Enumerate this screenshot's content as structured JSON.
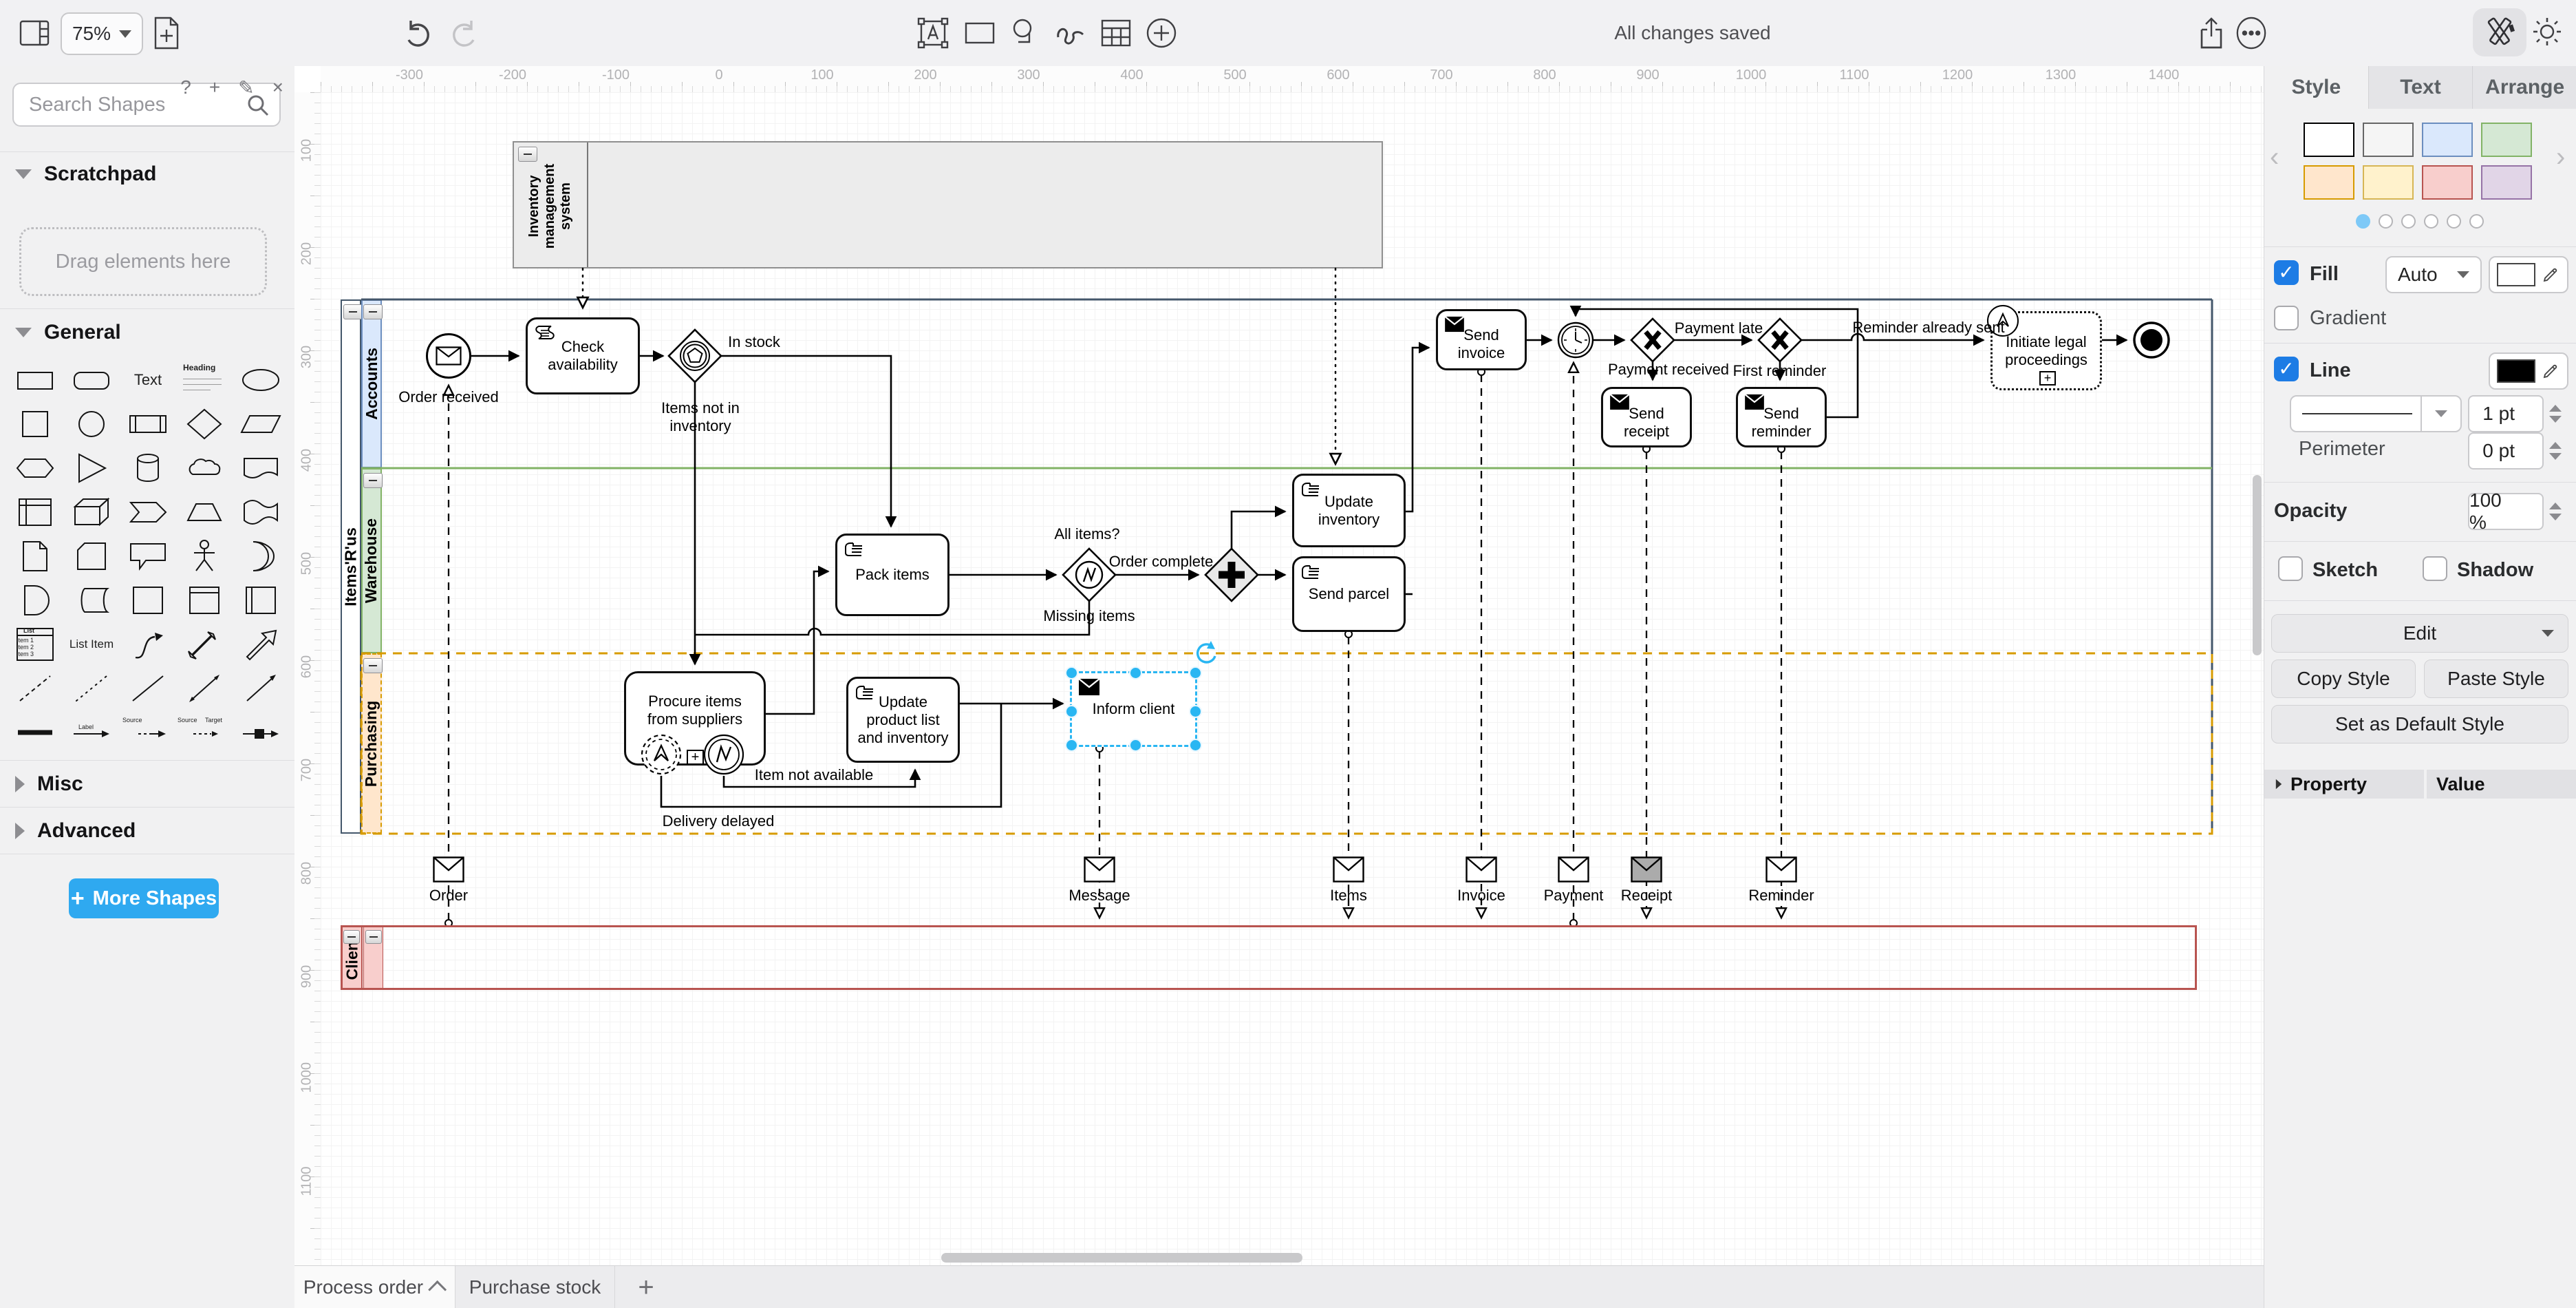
{
  "toolbar": {
    "zoom": "75%",
    "status": "All changes saved"
  },
  "sidebar": {
    "search_placeholder": "Search Shapes",
    "scratchpad_title": "Scratchpad",
    "drag_hint": "Drag elements here",
    "section_general": "General",
    "section_misc": "Misc",
    "section_advanced": "Advanced",
    "more_shapes": "More Shapes",
    "palette": {
      "text": "Text",
      "heading": "Heading",
      "list": "List",
      "item1": "Item 1",
      "item2": "Item 2",
      "item3": "Item 3",
      "list_item": "List Item",
      "label": "Label",
      "source": "Source",
      "target": "Target"
    }
  },
  "rulers": {
    "top": [
      "-300",
      "-200",
      "-100",
      "0",
      "100",
      "200",
      "300",
      "400",
      "500",
      "600",
      "700",
      "800",
      "900",
      "1000",
      "1100",
      "1200",
      "1300",
      "1400"
    ],
    "left": [
      "100",
      "200",
      "300",
      "400",
      "500",
      "600",
      "700",
      "800",
      "900",
      "1000",
      "1100"
    ]
  },
  "diagram": {
    "ims_label": "Inventory management system",
    "pool_label": "Items'R'us",
    "lane_accounts": "Accounts",
    "lane_warehouse": "Warehouse",
    "lane_purchasing": "Purchasing",
    "client_label": "Client",
    "tasks": {
      "check": "Check availability",
      "pack": "Pack items",
      "upd_inv": "Update inventory",
      "parcel": "Send parcel",
      "procure": "Procure items from suppliers",
      "upl": "Update product list and inventory",
      "inform": "Inform client",
      "invoice": "Send invoice",
      "receipt": "Send receipt",
      "reminder": "Send reminder",
      "legal": "Initiate legal proceedings"
    },
    "events": {
      "order_received": "Order received"
    },
    "edge_labels": {
      "in_stock": "In stock",
      "items_not": "Items not in inventory",
      "all_items": "All items?",
      "order_complete": "Order complete",
      "missing": "Missing items",
      "item_na": "Item not available",
      "delayed": "Delivery delayed",
      "pay_late": "Payment late",
      "pay_recv": "Payment received",
      "first_rem": "First reminder",
      "rem_sent": "Reminder already sent"
    },
    "messages": {
      "order": "Order",
      "message": "Message",
      "items": "Items",
      "invoice": "Invoice",
      "payment": "Payment",
      "receipt": "Receipt",
      "reminder": "Reminder"
    }
  },
  "panel": {
    "tabs": [
      "Style",
      "Text",
      "Arrange"
    ],
    "fill_label": "Fill",
    "fill_mode": "Auto",
    "gradient_label": "Gradient",
    "line_label": "Line",
    "line_width": "1 pt",
    "perimeter_label": "Perimeter",
    "perimeter_value": "0 pt",
    "opacity_label": "Opacity",
    "opacity_value": "100 %",
    "sketch_label": "Sketch",
    "shadow_label": "Shadow",
    "edit_label": "Edit",
    "copy_style": "Copy Style",
    "paste_style": "Paste Style",
    "set_default": "Set as Default Style",
    "property_label": "Property",
    "value_label": "Value",
    "swatches": [
      {
        "fill": "#ffffff",
        "stroke": "#000000"
      },
      {
        "fill": "#f5f5f5",
        "stroke": "#666666"
      },
      {
        "fill": "#dae8fc",
        "stroke": "#6c8ebf"
      },
      {
        "fill": "#d5e8d4",
        "stroke": "#82b366"
      },
      {
        "fill": "#ffe6cc",
        "stroke": "#d79b00"
      },
      {
        "fill": "#fff2cc",
        "stroke": "#d6b656"
      },
      {
        "fill": "#f8cecc",
        "stroke": "#b85450"
      },
      {
        "fill": "#e1d5e7",
        "stroke": "#9673a6"
      }
    ]
  },
  "footer": {
    "tab_active": "Process order",
    "tab_other": "Purchase stock"
  }
}
